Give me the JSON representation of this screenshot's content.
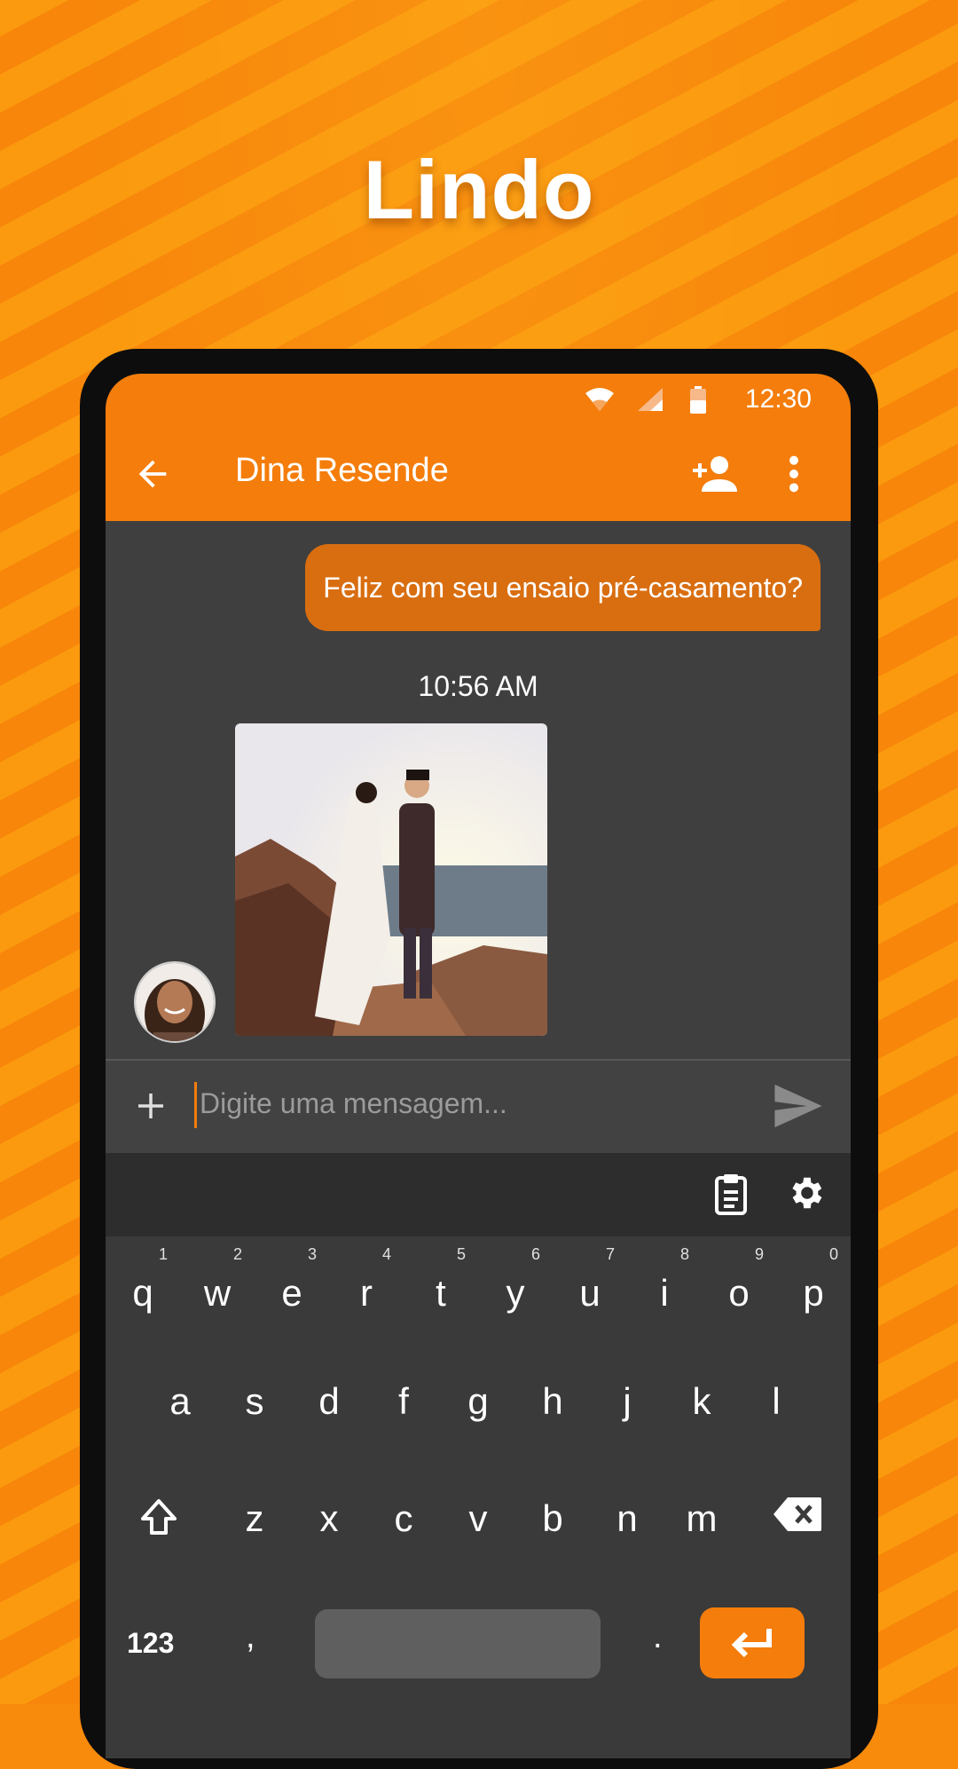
{
  "promo": {
    "headline": "Lindo"
  },
  "status_bar": {
    "time": "12:30"
  },
  "app_bar": {
    "contact_name": "Dina Resende",
    "back_icon": "arrow-back-icon",
    "add_contact_icon": "person-add-icon",
    "menu_icon": "more-vert-icon"
  },
  "messages": {
    "sent_text": "Feliz com seu ensaio pré-casamento?",
    "timestamp": "10:56 AM"
  },
  "composer": {
    "placeholder": "Digite uma mensagem..."
  },
  "keyboard": {
    "row1": [
      {
        "k": "q",
        "h": "1"
      },
      {
        "k": "w",
        "h": "2"
      },
      {
        "k": "e",
        "h": "3"
      },
      {
        "k": "r",
        "h": "4"
      },
      {
        "k": "t",
        "h": "5"
      },
      {
        "k": "y",
        "h": "6"
      },
      {
        "k": "u",
        "h": "7"
      },
      {
        "k": "i",
        "h": "8"
      },
      {
        "k": "o",
        "h": "9"
      },
      {
        "k": "p",
        "h": "0"
      }
    ],
    "row2": [
      "a",
      "s",
      "d",
      "f",
      "g",
      "h",
      "j",
      "k",
      "l"
    ],
    "row3": [
      "z",
      "x",
      "c",
      "v",
      "b",
      "n",
      "m"
    ],
    "numbers_key": "123",
    "comma_key": ",",
    "period_key": "."
  },
  "colors": {
    "accent": "#f47d0b",
    "sent_bubble": "#d96e10",
    "chat_bg": "#3f3f3f"
  }
}
